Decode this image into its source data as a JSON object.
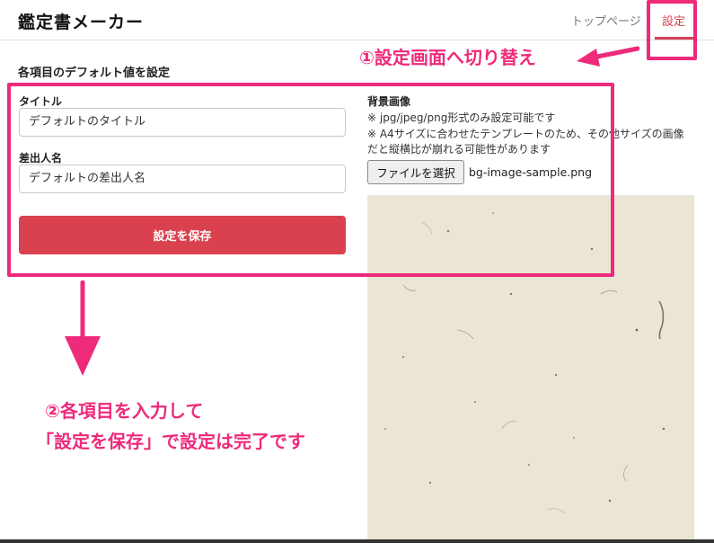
{
  "header": {
    "app_title": "鑑定書メーカー",
    "nav_top": "トップページ",
    "nav_settings": "設定"
  },
  "form": {
    "section_title": "各項目のデフォルト値を設定",
    "title_label": "タイトル",
    "title_value": "デフォルトのタイトル",
    "sender_label": "差出人名",
    "sender_value": "デフォルトの差出人名",
    "save_label": "設定を保存"
  },
  "background": {
    "label": "背景画像",
    "note1": "※ jpg/jpeg/png形式のみ設定可能です",
    "note2": "※ A4サイズに合わせたテンプレートのため、その他サイズの画像",
    "note3": "だと縦横比が崩れる可能性があります",
    "file_button": "ファイルを選択",
    "file_name": "bg-image-sample.png"
  },
  "annotations": {
    "step1": "①設定画面へ切り替え",
    "step2_line1": "②各項目を入力して",
    "step2_line2": "「設定を保存」で設定は完了です",
    "color": "#ee2a7b"
  },
  "colors": {
    "accent": "#d9414f",
    "paper": "#ece6d8"
  }
}
